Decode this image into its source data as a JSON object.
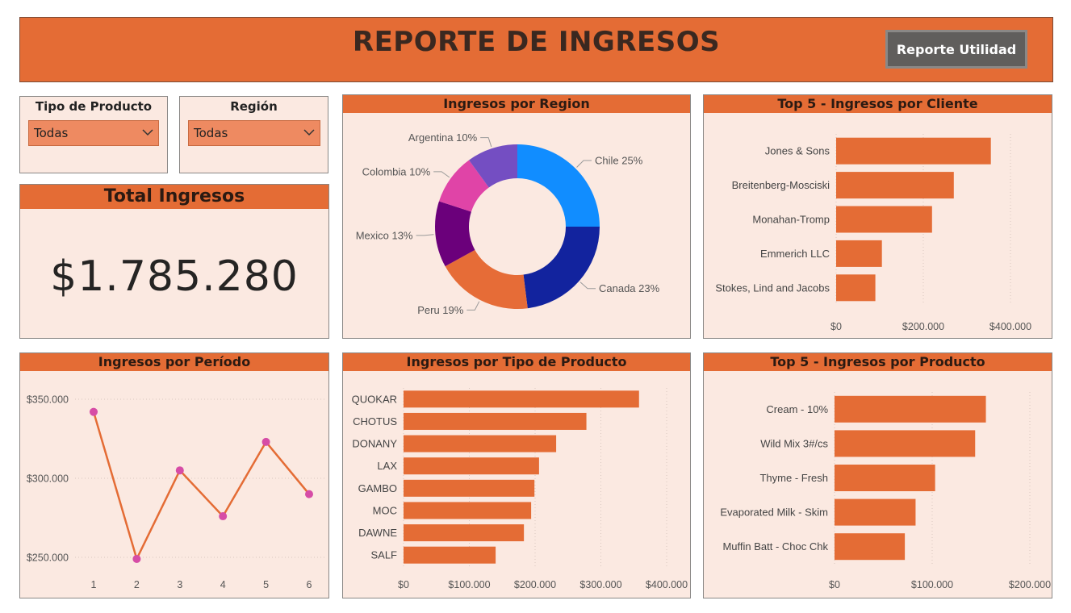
{
  "header": {
    "title": "REPORTE DE INGRESOS",
    "button_label": "Reporte Utilidad"
  },
  "filters": {
    "product_type": {
      "label": "Tipo de Producto",
      "value": "Todas"
    },
    "region": {
      "label": "Región",
      "value": "Todas"
    }
  },
  "kpi": {
    "title": "Total Ingresos",
    "value": "$1.785.280"
  },
  "panels": {
    "region": "Ingresos por Region",
    "top_clients": "Top 5 - Ingresos por Cliente",
    "period": "Ingresos por Período",
    "product_type": "Ingresos por Tipo de Producto",
    "top_products": "Top 5 - Ingresos por Producto"
  },
  "colors": {
    "accent": "#e46c35",
    "panel_bg": "#fbe9e1",
    "marker": "#d64ca6"
  },
  "chart_data": [
    {
      "id": "region",
      "type": "pie",
      "variant": "donut",
      "labels": [
        "Chile",
        "Canada",
        "Peru",
        "Mexico",
        "Colombia",
        "Argentina"
      ],
      "values": [
        25,
        23,
        19,
        13,
        10,
        10
      ],
      "display_labels": [
        "Chile 25%",
        "Canada 23%",
        "Peru 19%",
        "Mexico 13%",
        "Colombia 10%",
        "Argentina 10%"
      ],
      "colors": [
        "#118dff",
        "#12239e",
        "#e66c37",
        "#6b007b",
        "#e044a7",
        "#744ec2"
      ]
    },
    {
      "id": "top_clients",
      "type": "bar",
      "orientation": "horizontal",
      "categories": [
        "Jones & Sons",
        "Breitenberg-Mosciski",
        "Monahan-Tromp",
        "Emmerich LLC",
        "Stokes, Lind and Jacobs"
      ],
      "values": [
        355000,
        270000,
        220000,
        105000,
        90000
      ],
      "xlim": [
        0,
        450000
      ],
      "ticks": [
        0,
        200000,
        400000
      ],
      "tick_labels": [
        "$0",
        "$200.000",
        "$400.000"
      ]
    },
    {
      "id": "period",
      "type": "line",
      "x": [
        1,
        2,
        3,
        4,
        5,
        6
      ],
      "values": [
        342000,
        249000,
        305000,
        276000,
        323000,
        290000
      ],
      "ylim": [
        240000,
        360000
      ],
      "ticks": [
        250000,
        300000,
        350000
      ],
      "tick_labels": [
        "$250.000",
        "$300.000",
        "$350.000"
      ]
    },
    {
      "id": "product_type",
      "type": "bar",
      "orientation": "horizontal",
      "categories": [
        "QUOKAR",
        "CHOTUS",
        "DONANY",
        "LAX",
        "GAMBO",
        "MOC",
        "DAWNE",
        "SALF"
      ],
      "values": [
        358000,
        278000,
        232000,
        206000,
        199000,
        194000,
        183000,
        140000
      ],
      "xlim": [
        0,
        400000
      ],
      "ticks": [
        0,
        100000,
        200000,
        300000,
        400000
      ],
      "tick_labels": [
        "$0",
        "$100.000",
        "$200.000",
        "$300.000",
        "$400.000"
      ]
    },
    {
      "id": "top_products",
      "type": "bar",
      "orientation": "horizontal",
      "categories": [
        "Cream - 10%",
        "Wild Mix 3#/cs",
        "Thyme - Fresh",
        "Evaporated Milk - Skim",
        "Muffin Batt - Choc Chk"
      ],
      "values": [
        155000,
        144000,
        103000,
        83000,
        72000
      ],
      "xlim": [
        0,
        200000
      ],
      "ticks": [
        0,
        100000,
        200000
      ],
      "tick_labels": [
        "$0",
        "$100.000",
        "$200.000"
      ]
    }
  ]
}
